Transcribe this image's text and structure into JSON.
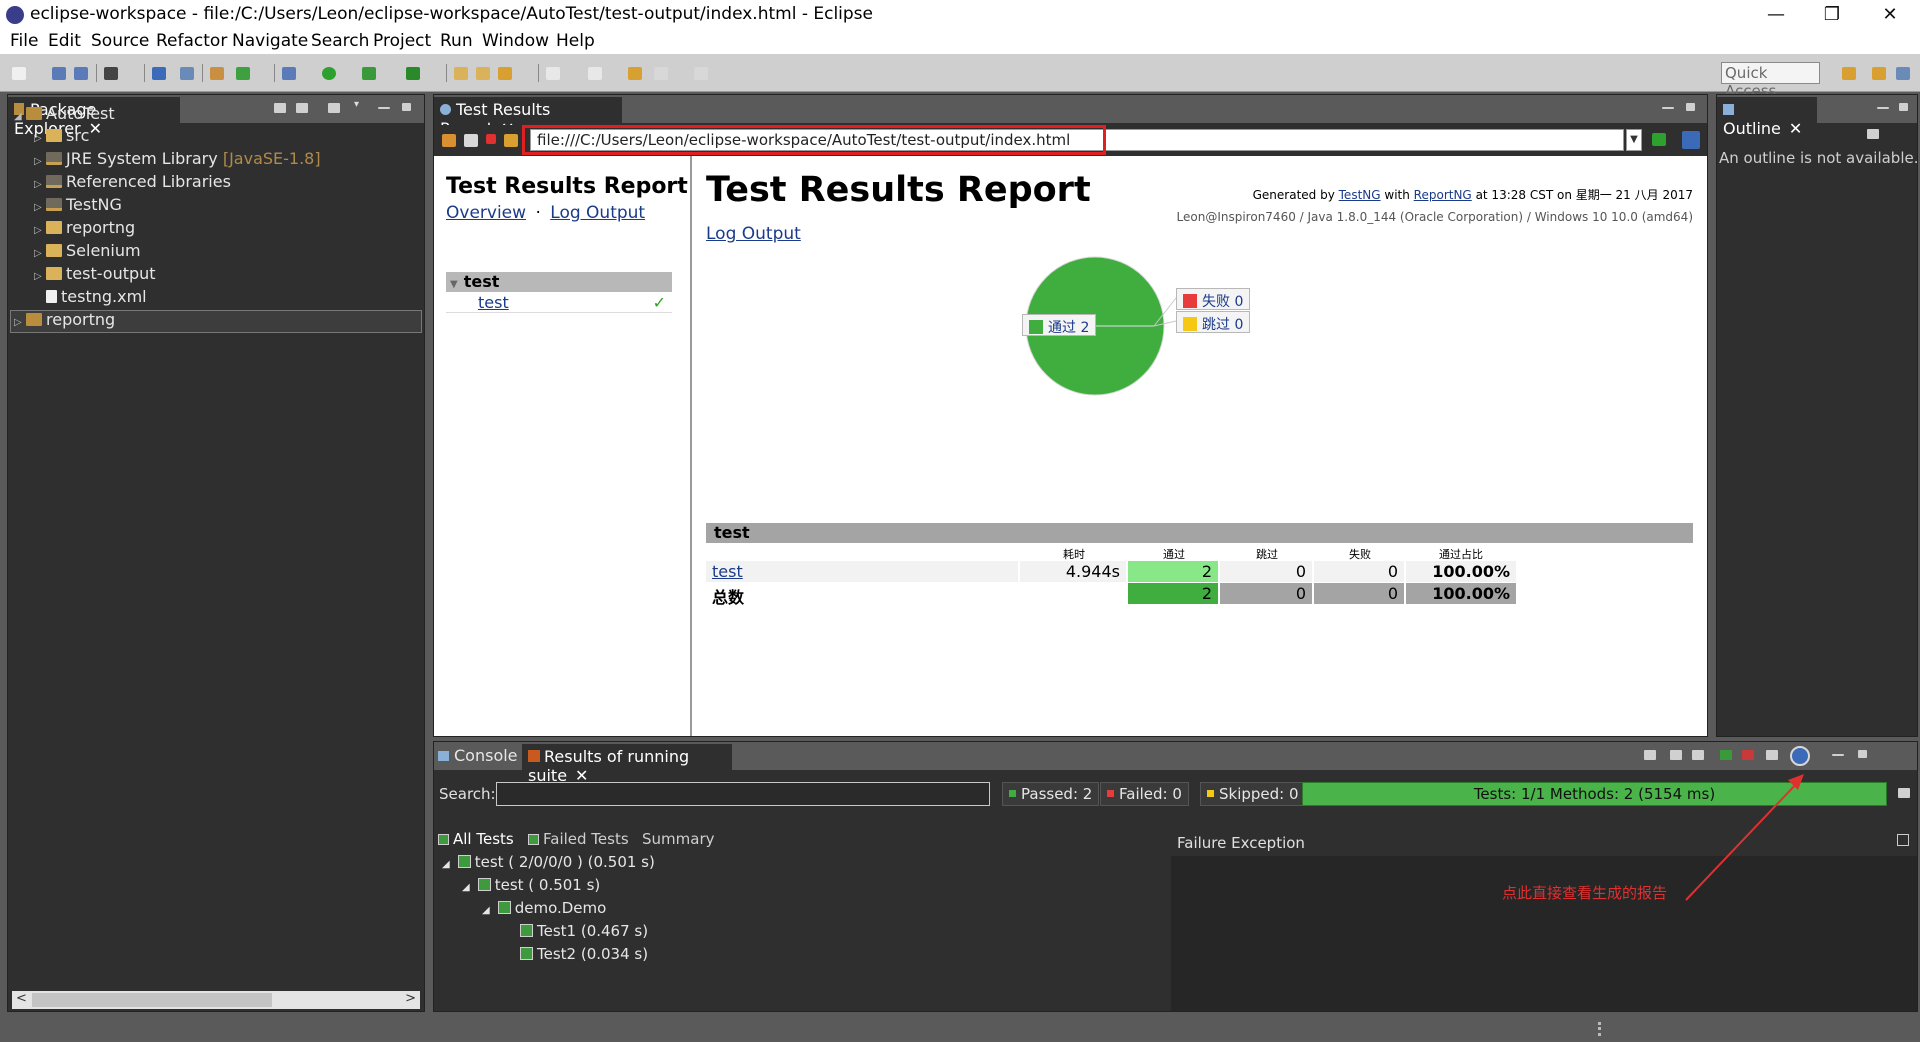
{
  "window": {
    "title": "eclipse-workspace - file:/C:/Users/Leon/eclipse-workspace/AutoTest/test-output/index.html - Eclipse",
    "minimize": "—",
    "maximize": "❐",
    "close": "✕"
  },
  "menu": [
    "File",
    "Edit",
    "Source",
    "Refactor",
    "Navigate",
    "Search",
    "Project",
    "Run",
    "Window",
    "Help"
  ],
  "toolbar": {
    "quick_access": "Quick Access"
  },
  "package_explorer": {
    "tab_label": "Package Explorer",
    "close": "✕",
    "items": [
      {
        "label": "AutoTest",
        "decoration": ""
      },
      {
        "label": "src",
        "decoration": ""
      },
      {
        "label": "JRE System Library",
        "decoration": "[JavaSE-1.8]"
      },
      {
        "label": "Referenced Libraries",
        "decoration": ""
      },
      {
        "label": "TestNG",
        "decoration": ""
      },
      {
        "label": "reportng",
        "decoration": ""
      },
      {
        "label": "Selenium",
        "decoration": ""
      },
      {
        "label": "test-output",
        "decoration": ""
      },
      {
        "label": "testng.xml",
        "decoration": ""
      },
      {
        "label": "reportng",
        "decoration": ""
      }
    ],
    "scroll_left": "<",
    "scroll_right": ">"
  },
  "editor": {
    "tab_label": "Test Results Report",
    "close": "✕",
    "url": "file:///C:/Users/Leon/eclipse-workspace/AutoTest/test-output/index.html"
  },
  "report": {
    "nav_title": "Test Results Report",
    "nav_overview": "Overview",
    "nav_sep": "·",
    "nav_log": "Log Output",
    "suite_name": "test",
    "suite_item": "test",
    "suite_check": "✓",
    "title": "Test Results Report",
    "generated_prefix": "Generated by",
    "generated_tool1": "TestNG",
    "generated_with": "with",
    "generated_tool2": "ReportNG",
    "generated_suffix": "at 13:28 CST on 星期一 21 八月 2017",
    "env": "Leon@Inspiron7460 / Java 1.8.0_144 (Oracle Corporation) / Windows 10 10.0 (amd64)",
    "log_output": "Log Output",
    "chart": {
      "pass_label": "通过 2",
      "fail_label": "失败 0",
      "skip_label": "跳过 0",
      "pass_color": "#3fae3f",
      "fail_color": "#e83c3c",
      "skip_color": "#f5c816"
    },
    "table": {
      "group": "test",
      "headers": [
        "耗时",
        "通过",
        "跳过",
        "失败",
        "通过占比"
      ],
      "row": {
        "name": "test",
        "duration": "4.944s",
        "passed": "2",
        "skipped": "0",
        "failed": "0",
        "pct": "100.00%"
      },
      "total": {
        "name": "总数",
        "passed": "2",
        "skipped": "0",
        "failed": "0",
        "pct": "100.00%"
      }
    }
  },
  "outline": {
    "tab_label": "Outline",
    "close": "✕",
    "message": "An outline is not available."
  },
  "bottom": {
    "tab_console": "Console",
    "tab_results": "Results of running suite",
    "close": "✕",
    "search_label": "Search:",
    "passed": "Passed: 2",
    "failed": "Failed: 0",
    "skipped": "Skipped: 0",
    "progress": "Tests: 1/1  Methods: 2 (5154 ms)",
    "tabs": [
      "All Tests",
      "Failed Tests",
      "Summary"
    ],
    "tree": [
      {
        "label": "test ( 2/0/0/0 ) (0.501 s)"
      },
      {
        "label": "test ( 0.501 s)"
      },
      {
        "label": "demo.Demo"
      },
      {
        "label": "Test1  (0.467 s)"
      },
      {
        "label": "Test2  (0.034 s)"
      }
    ],
    "failure_title": "Failure Exception",
    "annotation": "点此直接查看生成的报告"
  }
}
